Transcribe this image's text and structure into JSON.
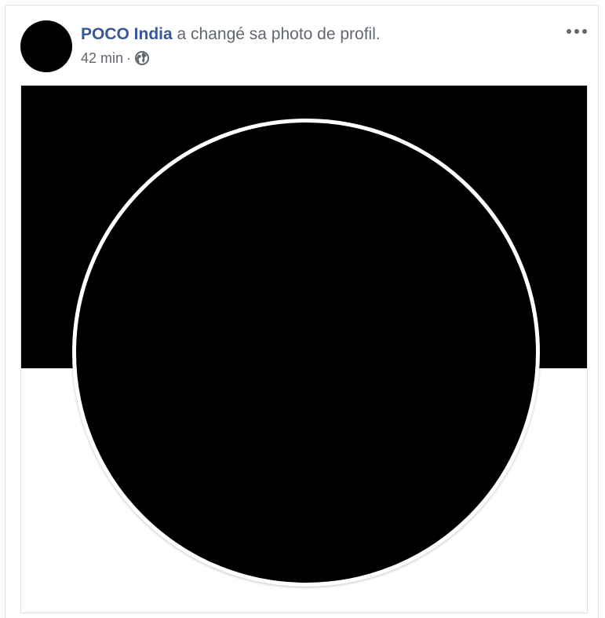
{
  "post": {
    "page_name": "POCO India",
    "action_text": "a changé sa photo de profil.",
    "timestamp": "42 min",
    "separator": "·",
    "audience_icon": "globe-icon",
    "more_icon": "more-options-icon"
  },
  "colors": {
    "link": "#385898",
    "secondary_text": "#616770",
    "border": "#dddfe2",
    "photo_background": "#000000"
  }
}
